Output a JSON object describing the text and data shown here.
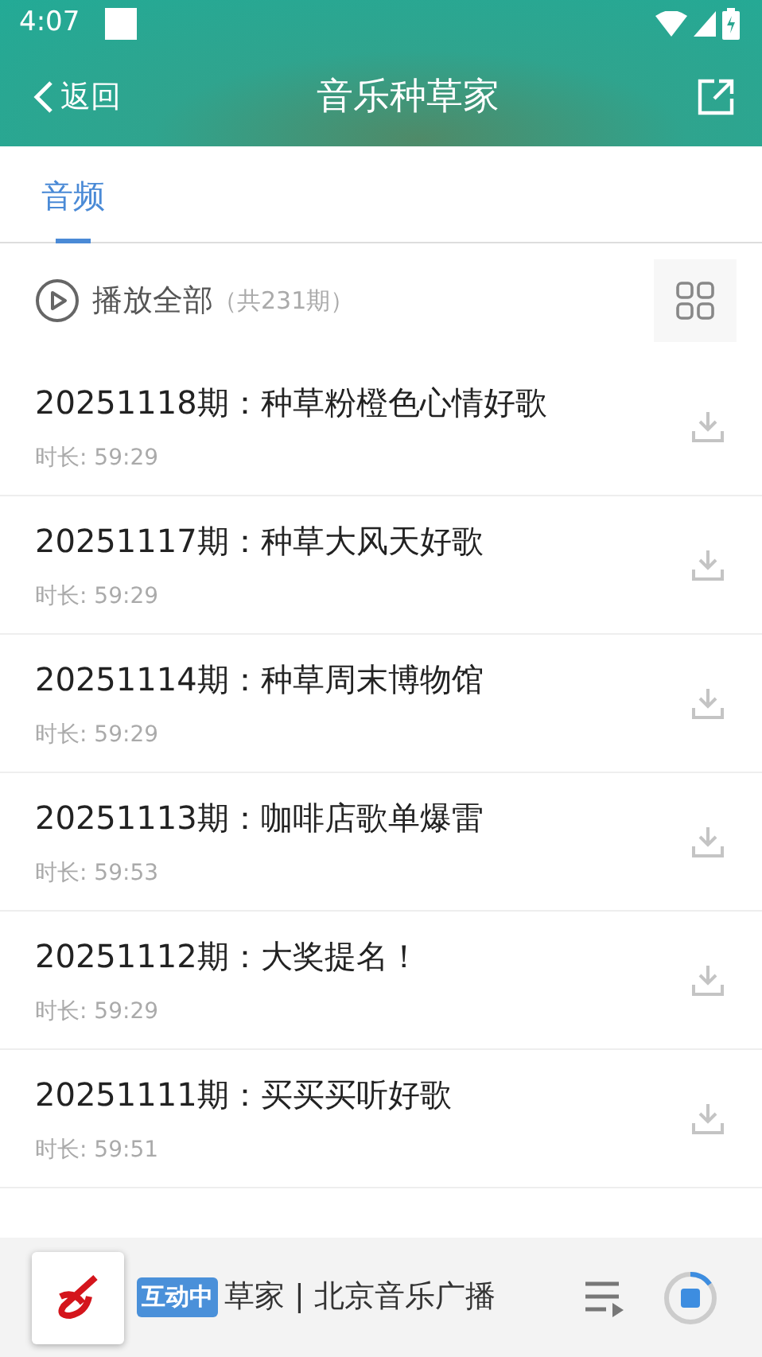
{
  "status_bar": {
    "time": "4:07"
  },
  "header": {
    "back": "返回",
    "title": "音乐种草家"
  },
  "tabs": [
    {
      "label": "音频",
      "selected": true
    }
  ],
  "play_all": {
    "label": "播放全部",
    "count": "（共231期）"
  },
  "episodes": [
    {
      "title": "20251118期：种草粉橙色心情好歌",
      "duration": "时长: 59:29"
    },
    {
      "title": "20251117期：种草大风天好歌",
      "duration": "时长: 59:29"
    },
    {
      "title": "20251114期：种草周末博物馆",
      "duration": "时长: 59:29"
    },
    {
      "title": "20251113期：咖啡店歌单爆雷",
      "duration": "时长: 59:53"
    },
    {
      "title": "20251112期：大奖提名！",
      "duration": "时长: 59:29"
    },
    {
      "title": "20251111期：买买买听好歌",
      "duration": "时长: 59:51"
    }
  ],
  "player": {
    "badge": "互动中",
    "text": "草家 | 北京音乐广播",
    "level": 0.15
  }
}
